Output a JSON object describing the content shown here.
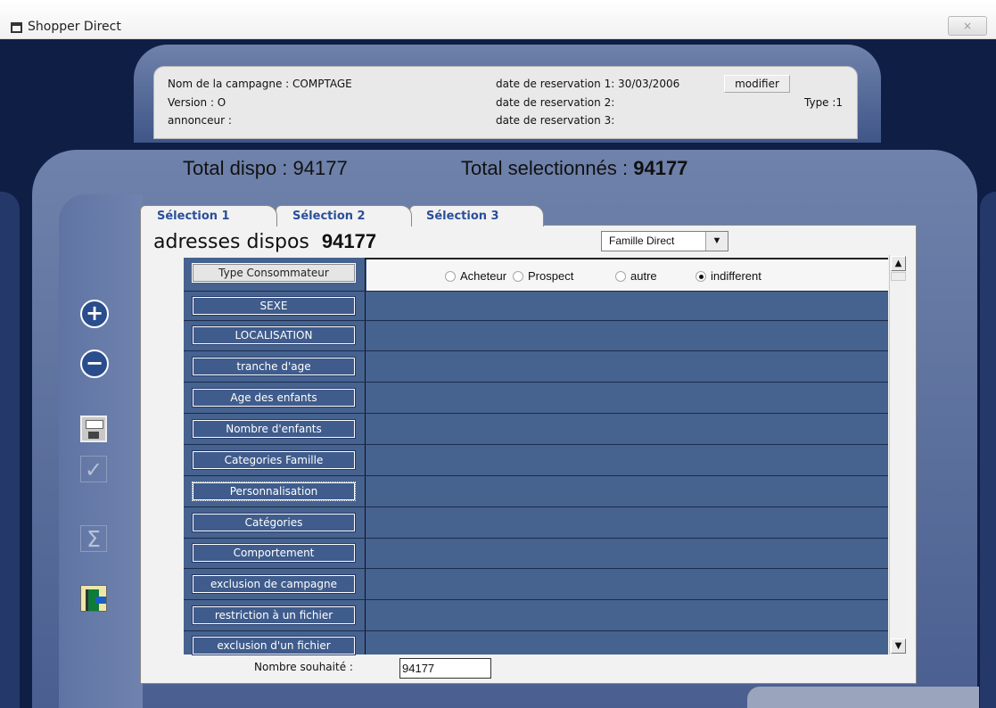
{
  "window": {
    "title": "Shopper Direct",
    "close_label": "×"
  },
  "campaign": {
    "name_label": "Nom de la campagne : COMPTAGE",
    "version_label": "Version : O",
    "annonceur_label": "annonceur :",
    "date1_label": "date de reservation 1: 30/03/2006",
    "date2_label": "date de reservation 2:",
    "date3_label": "date de reservation 3:",
    "modify_button": "modifier",
    "type_label": "Type :1"
  },
  "totals": {
    "dispo_label": "Total dispo :",
    "dispo_value": "94177",
    "selected_label": "Total selectionnés :",
    "selected_value": "94177"
  },
  "tabs": [
    {
      "label": "Sélection 1"
    },
    {
      "label": "Sélection 2"
    },
    {
      "label": "Sélection 3"
    }
  ],
  "main": {
    "adresses_label": "adresses dispos",
    "adresses_value": "94177",
    "famille_selected": "Famille Direct",
    "nombre_label": "Nombre souhaité :",
    "nombre_value": "94177"
  },
  "criteria": [
    {
      "label": "Type  Consommateur"
    },
    {
      "label": "SEXE"
    },
    {
      "label": "LOCALISATION"
    },
    {
      "label": "tranche d'age"
    },
    {
      "label": "Age des enfants"
    },
    {
      "label": "Nombre d'enfants"
    },
    {
      "label": "Categories Famille"
    },
    {
      "label": "Personnalisation"
    },
    {
      "label": "Catégories"
    },
    {
      "label": "Comportement"
    },
    {
      "label": "exclusion de campagne"
    },
    {
      "label": "restriction à un fichier"
    },
    {
      "label": "exclusion d'un fichier"
    }
  ],
  "consumer_options": [
    {
      "label": "Acheteur",
      "checked": false
    },
    {
      "label": "Prospect",
      "checked": false
    },
    {
      "label": "autre",
      "checked": false
    },
    {
      "label": "indifferent",
      "checked": true
    }
  ],
  "side_icons": [
    "zoom-in-icon",
    "zoom-out-icon",
    "save-icon",
    "check-icon",
    "sigma-icon",
    "exit-door-icon"
  ]
}
